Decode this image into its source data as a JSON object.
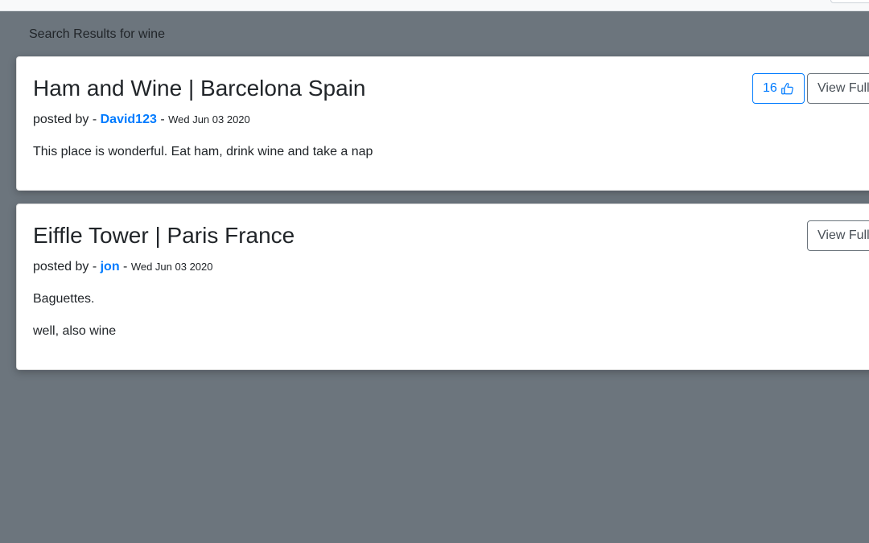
{
  "search": {
    "heading": "Search Results for wine"
  },
  "posts": [
    {
      "title": "Ham and Wine | Barcelona Spain",
      "posted_by_label": "posted by - ",
      "author": "David123",
      "separator": " - ",
      "date": "Wed Jun 03 2020",
      "paragraphs": [
        "This place is wonderful.  Eat ham, drink wine and take a nap"
      ],
      "likes": "16",
      "like_icon": "thumbs-up-icon",
      "view_label": "View Full"
    },
    {
      "title": "Eiffle Tower | Paris France",
      "posted_by_label": "posted by - ",
      "author": "jon",
      "separator": " - ",
      "date": "Wed Jun 03 2020",
      "paragraphs": [
        "Baguettes.",
        "well, also wine"
      ],
      "view_label": "View Full"
    }
  ]
}
